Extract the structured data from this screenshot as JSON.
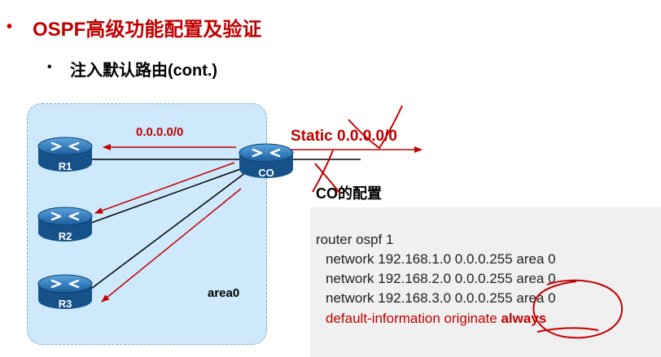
{
  "title": {
    "bullet": "•",
    "text": "OSPF高级功能配置及验证"
  },
  "subtitle": {
    "bullet": "•",
    "text": "注入默认路由(cont.)"
  },
  "diagram": {
    "area_label": "area0",
    "route_label": "0.0.0.0/0",
    "static_label": "Static 0.0.0.0/0",
    "routers": {
      "r1": "R1",
      "r2": "R2",
      "r3": "R3",
      "co": "CO"
    }
  },
  "config": {
    "title": "CO的配置",
    "lines": [
      "router ospf 1",
      "network 192.168.1.0 0.0.0.255 area 0",
      "network 192.168.2.0 0.0.0.255 area 0",
      "network 192.168.3.0 0.0.0.255 area 0"
    ],
    "default_prefix": "default-information originate ",
    "default_keyword": "always"
  },
  "colors": {
    "accent_red": "#c00000",
    "router_blue": "#1a6fb5",
    "area_fill": "#cde9fb",
    "config_bg": "#f0f0f0"
  }
}
